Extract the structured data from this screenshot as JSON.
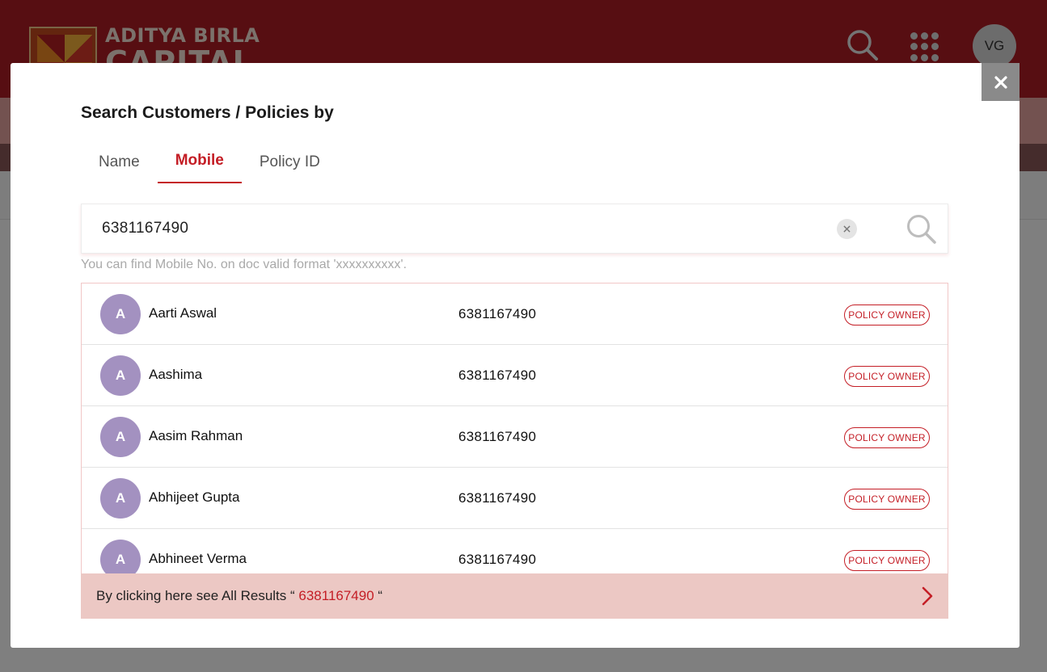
{
  "header": {
    "logo_line1": "ADITYA BIRLA",
    "logo_line2": "CAPITAL",
    "avatar_initials": "VG",
    "icons": [
      "search-icon",
      "apps-grid-icon"
    ]
  },
  "modal": {
    "title": "Search Customers / Policies by",
    "close_icon": "close-icon",
    "tabs": [
      {
        "label": "Name",
        "active": false
      },
      {
        "label": "Mobile",
        "active": true
      },
      {
        "label": "Policy ID",
        "active": false
      }
    ],
    "search": {
      "value": "6381167490",
      "clear_icon": "clear-icon",
      "search_icon": "search-icon"
    },
    "helper_text": "You can find Mobile No. on doc valid format 'xxxxxxxxxx'.",
    "results": [
      {
        "initial": "A",
        "name": "Aarti Aswal",
        "mobile": "6381167490",
        "badge": "POLICY OWNER"
      },
      {
        "initial": "A",
        "name": "Aashima",
        "mobile": "6381167490",
        "badge": "POLICY OWNER"
      },
      {
        "initial": "A",
        "name": "Aasim Rahman",
        "mobile": "6381167490",
        "badge": "POLICY OWNER"
      },
      {
        "initial": "A",
        "name": "Abhijeet Gupta",
        "mobile": "6381167490",
        "badge": "POLICY OWNER"
      },
      {
        "initial": "A",
        "name": "Abhineet Verma",
        "mobile": "6381167490",
        "badge": "POLICY OWNER"
      }
    ],
    "all_results": {
      "prefix": "By clicking here see All Results “ ",
      "query": "6381167490",
      "suffix": " “"
    }
  },
  "colors": {
    "brand_red": "#c41e26",
    "avatar_purple": "#a391c0",
    "all_results_bg": "#ecc8c4"
  }
}
